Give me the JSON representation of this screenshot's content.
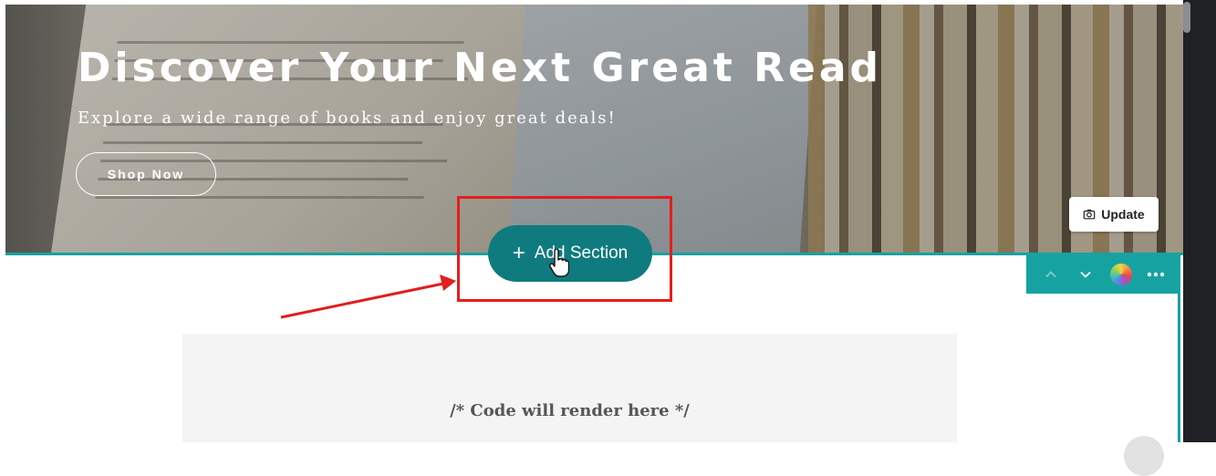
{
  "hero": {
    "title": "Discover Your Next Great Read",
    "subtitle": "Explore a wide range of books and enjoy great deals!",
    "cta_label": "Shop Now",
    "update_label": "Update"
  },
  "add_section": {
    "label": "Add Section"
  },
  "toolbar": {
    "icons": [
      "chevron-up-icon",
      "chevron-down-icon",
      "color-palette-icon",
      "more-icon"
    ],
    "accent_color": "#17a2a2"
  },
  "code_block": {
    "placeholder": "/* Code will render here */"
  },
  "colors": {
    "add_section_bg": "#0f7b7f",
    "annotation_red": "#e31e1e",
    "selection_teal": "#17a2a2"
  }
}
